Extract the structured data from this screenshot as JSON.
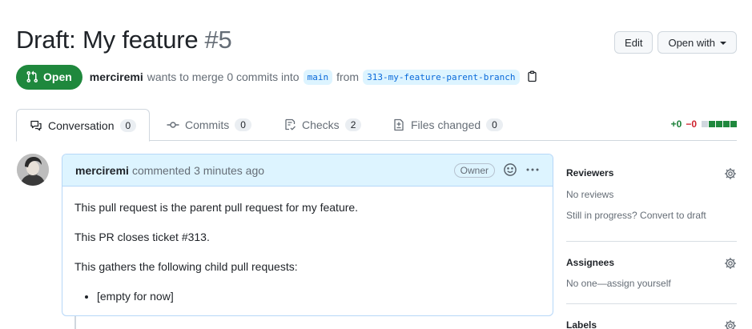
{
  "header": {
    "title": "Draft: My feature",
    "number": "#5",
    "edit_label": "Edit",
    "open_with_label": "Open with"
  },
  "meta": {
    "state": "Open",
    "author": "merciremi",
    "text_before": "wants to merge 0 commits into",
    "base_branch": "main",
    "from_word": "from",
    "head_branch": "313-my-feature-parent-branch"
  },
  "tabs": [
    {
      "label": "Conversation",
      "count": "0"
    },
    {
      "label": "Commits",
      "count": "0"
    },
    {
      "label": "Checks",
      "count": "2"
    },
    {
      "label": "Files changed",
      "count": "0"
    }
  ],
  "diffstat": {
    "additions": "+0",
    "deletions": "−0"
  },
  "comment": {
    "author": "merciremi",
    "action": "commented",
    "time": "3 minutes ago",
    "role_badge": "Owner",
    "paragraphs": [
      "This pull request is the parent pull request for my feature.",
      "This PR closes ticket #313.",
      "This gathers the following child pull requests:"
    ],
    "list_items": [
      "[empty for now]"
    ]
  },
  "sidebar": {
    "reviewers": {
      "title": "Reviewers",
      "value": "No reviews",
      "extra": "Still in progress? Convert to draft"
    },
    "assignees": {
      "title": "Assignees",
      "value": "No one—assign yourself"
    },
    "labels": {
      "title": "Labels"
    }
  },
  "colors": {
    "open_green": "#1f883d",
    "link_blue": "#0969da",
    "comment_header_bg": "#ddf4ff"
  }
}
